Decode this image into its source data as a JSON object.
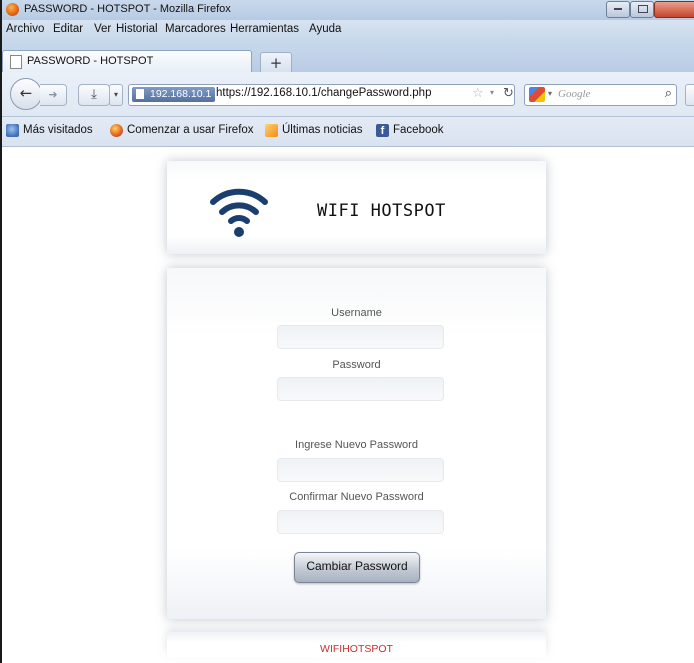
{
  "window": {
    "title": "PASSWORD - HOTSPOT - Mozilla Firefox"
  },
  "menu": {
    "items": [
      "Archivo",
      "Editar",
      "Ver",
      "Historial",
      "Marcadores",
      "Herramientas",
      "Ayuda"
    ]
  },
  "tabs": [
    {
      "label": "PASSWORD - HOTSPOT",
      "active": true
    }
  ],
  "navbar": {
    "site_identity": "192.168.10.1",
    "url": "https://192.168.10.1/changePassword.php",
    "search_placeholder": "Google"
  },
  "bookmarks": [
    {
      "label": "Más visitados",
      "icon": "most-visited-icon"
    },
    {
      "label": "Comenzar a usar Firefox",
      "icon": "firefox-icon"
    },
    {
      "label": "Últimas noticias",
      "icon": "rss-icon"
    },
    {
      "label": "Facebook",
      "icon": "facebook-icon"
    }
  ],
  "page": {
    "header_title": "WIFI HOTSPOT",
    "logo_icon": "wifi-icon",
    "form": {
      "username_label": "Username",
      "password_label": "Password",
      "new_password_label": "Ingrese Nuevo Password",
      "confirm_password_label": "Confirmar Nuevo Password",
      "submit_label": "Cambiar Password"
    },
    "footer_text": "WIFIHOTSPOT"
  },
  "colors": {
    "logo": "#1a3e6e",
    "footer_text": "#c4302b",
    "chrome": "#c9d9ec"
  }
}
